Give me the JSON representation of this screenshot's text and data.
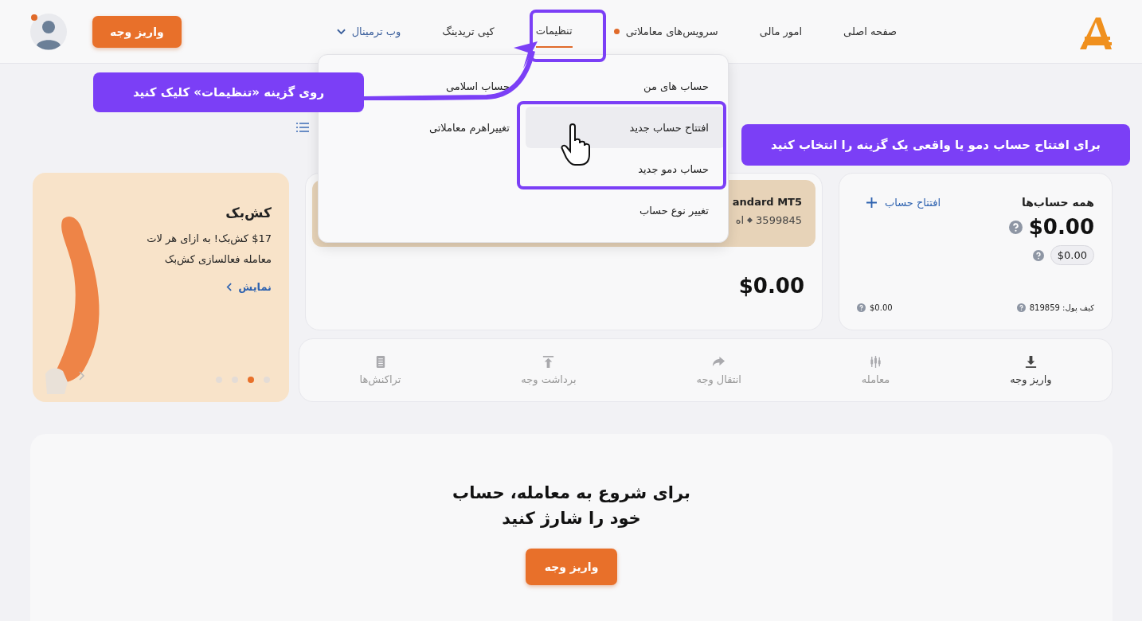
{
  "header": {
    "nav": [
      {
        "label": "صفحه اصلی",
        "kind": "link",
        "dot": false,
        "selected": false
      },
      {
        "label": "امور مالی",
        "kind": "link",
        "dot": false,
        "selected": false
      },
      {
        "label": "سرویس‌های معاملاتی",
        "kind": "link",
        "dot": true,
        "selected": false
      },
      {
        "label": "تنظیمات",
        "kind": "link",
        "dot": false,
        "selected": true
      },
      {
        "label": "کپی تریدینگ",
        "kind": "link",
        "dot": false,
        "selected": false
      },
      {
        "label": "وب ترمینال",
        "kind": "dropdown",
        "dot": false,
        "selected": false
      }
    ],
    "deposit_button": "واریز وجه",
    "avatar": {
      "notification": true
    }
  },
  "menu": {
    "columns": [
      {
        "items": [
          {
            "label": "حساب های من",
            "hovered": false
          },
          {
            "label": "افتتاح حساب جدید",
            "hovered": true
          },
          {
            "label": "حساب دمو جدید",
            "hovered": false
          },
          {
            "label": "تغییر نوع حساب",
            "hovered": false
          }
        ]
      },
      {
        "items": [
          {
            "label": "حساب اسلامی",
            "hovered": false
          },
          {
            "label": "تغییراهرم معاملاتی",
            "hovered": false
          }
        ]
      }
    ]
  },
  "annotations": [
    {
      "text": "روی گزینه «تنظیمات» کلیک کنید"
    },
    {
      "text": "برای افتتاح حساب دمو یا واقعی یک گزینه را انتخاب کنید"
    }
  ],
  "summary_card": {
    "title": "همه حساب‌ها",
    "open_account": "افتتاح حساب",
    "balance": "$0.00",
    "sub_balance": "$0.00",
    "wallet_label": "کیف پول: 819859",
    "wallet_balance": "$0.00"
  },
  "account_card": {
    "name": "andard MT5",
    "number": "3599845",
    "tag": "اه",
    "balance": "$0.00"
  },
  "promo": {
    "title": "کش‌بک",
    "text": "$17 کش‌بک! به ازای هر لات معامله فعالسازی کش‌بک",
    "link": "نمایش",
    "slides": [
      {
        "selected": false
      },
      {
        "selected": true
      },
      {
        "selected": false
      },
      {
        "selected": false
      }
    ]
  },
  "actions": [
    {
      "label": "واریز وجه",
      "kind": "deposit",
      "selected": true
    },
    {
      "label": "معامله",
      "kind": "trade",
      "selected": false
    },
    {
      "label": "انتقال وجه",
      "kind": "transfer",
      "selected": false
    },
    {
      "label": "برداشت وجه",
      "kind": "withdraw",
      "selected": false
    },
    {
      "label": "تراکنش‌ها",
      "kind": "history",
      "selected": false
    }
  ],
  "cta": {
    "title": "برای شروع به معامله، حساب خود را شارژ کنید",
    "button": "واریز وجه"
  }
}
